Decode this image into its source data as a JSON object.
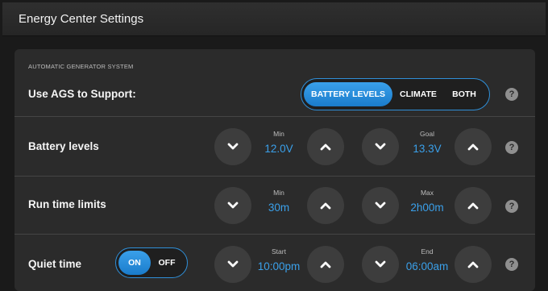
{
  "window": {
    "title": "Energy Center Settings"
  },
  "ags": {
    "section_label": "AUTOMATIC GENERATOR SYSTEM",
    "label": "Use AGS to Support:",
    "options": [
      "BATTERY LEVELS",
      "CLIMATE",
      "BOTH"
    ],
    "selected": "BATTERY LEVELS"
  },
  "battery": {
    "label": "Battery levels",
    "min_caption": "Min",
    "min_value": "12.0V",
    "goal_caption": "Goal",
    "goal_value": "13.3V"
  },
  "runtime": {
    "label": "Run time limits",
    "min_caption": "Min",
    "min_value": "30m",
    "max_caption": "Max",
    "max_value": "2h00m"
  },
  "quiet": {
    "label": "Quiet time",
    "toggle_on": "ON",
    "toggle_off": "OFF",
    "toggle_state": "ON",
    "start_caption": "Start",
    "start_value": "10:00pm",
    "end_caption": "End",
    "end_value": "06:00am"
  },
  "help_glyph": "?",
  "icons": {
    "decrease": "chevron-down-icon",
    "increase": "chevron-up-icon",
    "help": "help-icon"
  },
  "colors": {
    "accent": "#3aa0ea",
    "panel": "#2b2b2b",
    "button": "#3d3d3d"
  }
}
